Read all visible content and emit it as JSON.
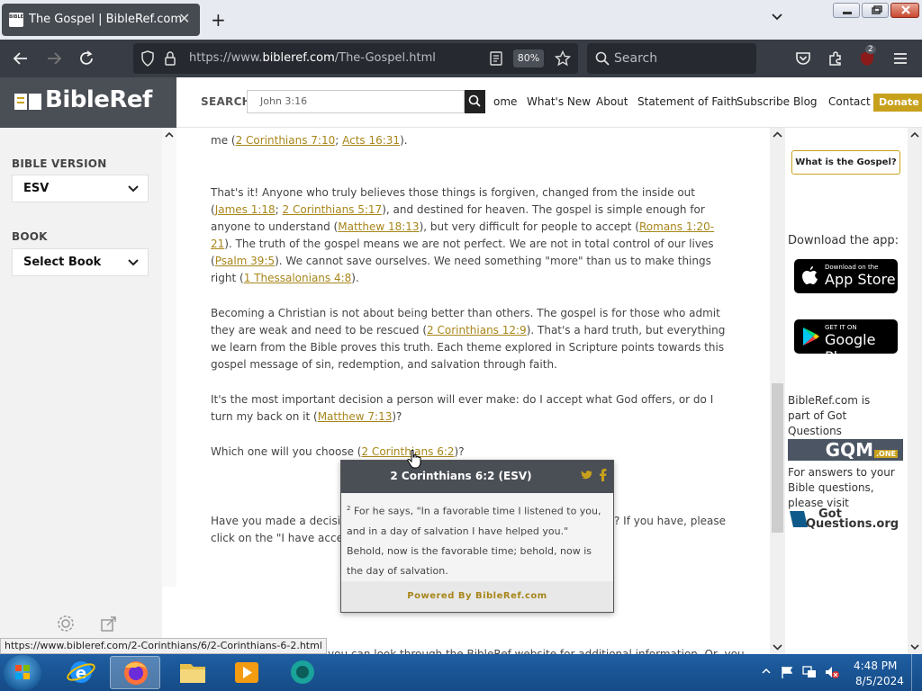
{
  "browser": {
    "tab_title": "The Gospel | BibleRef.com",
    "tab_favicon_text": "BIBLE",
    "url_prefix": "https://www.",
    "url_domain": "bibleref.com",
    "url_path": "/The-Gospel.html",
    "zoom": "80%",
    "search_placeholder": "Search",
    "extension_badge": "2"
  },
  "site": {
    "logo_text": "BibleRef",
    "search_label": "SEARCH",
    "search_value": "John 3:16",
    "nav": [
      "ome",
      "What's New",
      "About",
      "Statement of Faith",
      "Subscribe",
      "Blog",
      "Contact"
    ],
    "donate": "Donate"
  },
  "sidebar": {
    "version_label": "BIBLE VERSION",
    "version_value": "ESV",
    "book_label": "BOOK",
    "book_value": "Select Book"
  },
  "content": {
    "p0_text": "me (",
    "p0_refs": [
      "2 Corinthians 7:10",
      "Acts 16:31"
    ],
    "p1_a": "That's it! Anyone who truly believes those things is forgiven, changed from the inside out (",
    "p1_ref1": "James 1:18",
    "p1_sep1": "; ",
    "p1_ref2": "2 Corinthians 5:17",
    "p1_b": "), and destined for heaven. The gospel is simple enough for anyone to understand (",
    "p1_ref3": "Matthew 18:13",
    "p1_c": "), but very difficult for people to accept (",
    "p1_ref4": "Romans 1:20-21",
    "p1_d": "). The truth of the gospel means we are not perfect. We are not in total control of our lives (",
    "p1_ref5": "Psalm 39:5",
    "p1_e": "). We cannot save ourselves. We need something \"more\" than us to make things right (",
    "p1_ref6": "1 Thessalonians 4:8",
    "p1_f": ").",
    "p2_a": "Becoming a Christian is not about being better than others. The gospel is for those who admit they are weak and need to be rescued (",
    "p2_ref1": "2 Corinthians 12:9",
    "p2_b": "). That's a hard truth, but everything we learn from the Bible proves this truth. Each theme explored in Scripture points towards this gospel message of sin, redemption, and salvation through faith.",
    "p3_a": "It's the most important decision a person will ever make: do I accept what God offers, or do I turn my back on it (",
    "p3_ref1": "Matthew 7:13",
    "p3_b": ")?",
    "p4_a": "Which one will you choose (",
    "p4_ref1": "2 Corinthians 6:2",
    "p4_b": ")?",
    "p5_a": "Have you made a decisio",
    "p5_b": "? If you have, please",
    "p5_c": "click on the \"I have accep",
    "p6_partial": "you can look through the BibleRef website for additional information. Or, you"
  },
  "popup": {
    "title": "2 Corinthians 6:2 (ESV)",
    "verse_num": "2",
    "verse_text": "For he says, \"In a favorable time I listened to you, and in a day of salvation I have helped you.\" Behold, now is the favorable time; behold, now is the day of salvation.",
    "footer": "Powered By BibleRef.com"
  },
  "right": {
    "gospel_button": "What is the Gospel?",
    "download_label": "Download the app:",
    "appstore_small": "Download on the",
    "appstore_large": "App Store",
    "googleplay_small": "GET IT ON",
    "googleplay_large": "Google Play",
    "part_of": "BibleRef.com is part of Got Questions Ministries",
    "gqm_logo": "GQM",
    "gqm_suffix": ".ONE",
    "answers": "For answers to your Bible questions, please visit",
    "gq_logo_1": "Got",
    "gq_logo_2": "Questions.org"
  },
  "statusbar": {
    "url": "https://www.bibleref.com/2-Corinthians/6/2-Corinthians-6-2.html"
  },
  "taskbar": {
    "time": "4:48 PM",
    "date": "8/5/2024"
  },
  "colors": {
    "accent_gold": "#c8a11c",
    "link": "#a8861a",
    "header_dark": "#4a4e55",
    "browser_chrome": "#383c44"
  }
}
